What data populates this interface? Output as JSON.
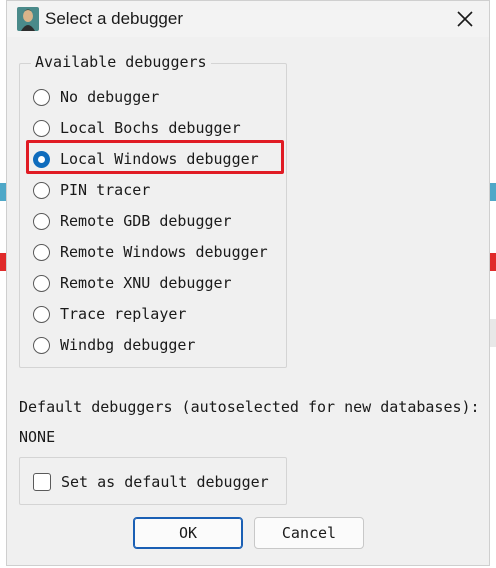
{
  "window": {
    "title": "Select a debugger",
    "accent_color": "#0f6cbd",
    "highlight_color": "#e01b24"
  },
  "group": {
    "legend": "Available debuggers",
    "options": [
      {
        "label": "No debugger",
        "selected": false
      },
      {
        "label": "Local Bochs debugger",
        "selected": false
      },
      {
        "label": "Local Windows debugger",
        "selected": true
      },
      {
        "label": "PIN tracer",
        "selected": false
      },
      {
        "label": "Remote GDB debugger",
        "selected": false
      },
      {
        "label": "Remote Windows debugger",
        "selected": false
      },
      {
        "label": "Remote XNU debugger",
        "selected": false
      },
      {
        "label": "Trace replayer",
        "selected": false
      },
      {
        "label": "Windbg debugger",
        "selected": false
      }
    ]
  },
  "defaults": {
    "label": "Default debuggers (autoselected for new databases):",
    "value": "NONE"
  },
  "checkbox": {
    "label": "Set as default debugger",
    "checked": false
  },
  "buttons": {
    "ok": "OK",
    "cancel": "Cancel"
  }
}
